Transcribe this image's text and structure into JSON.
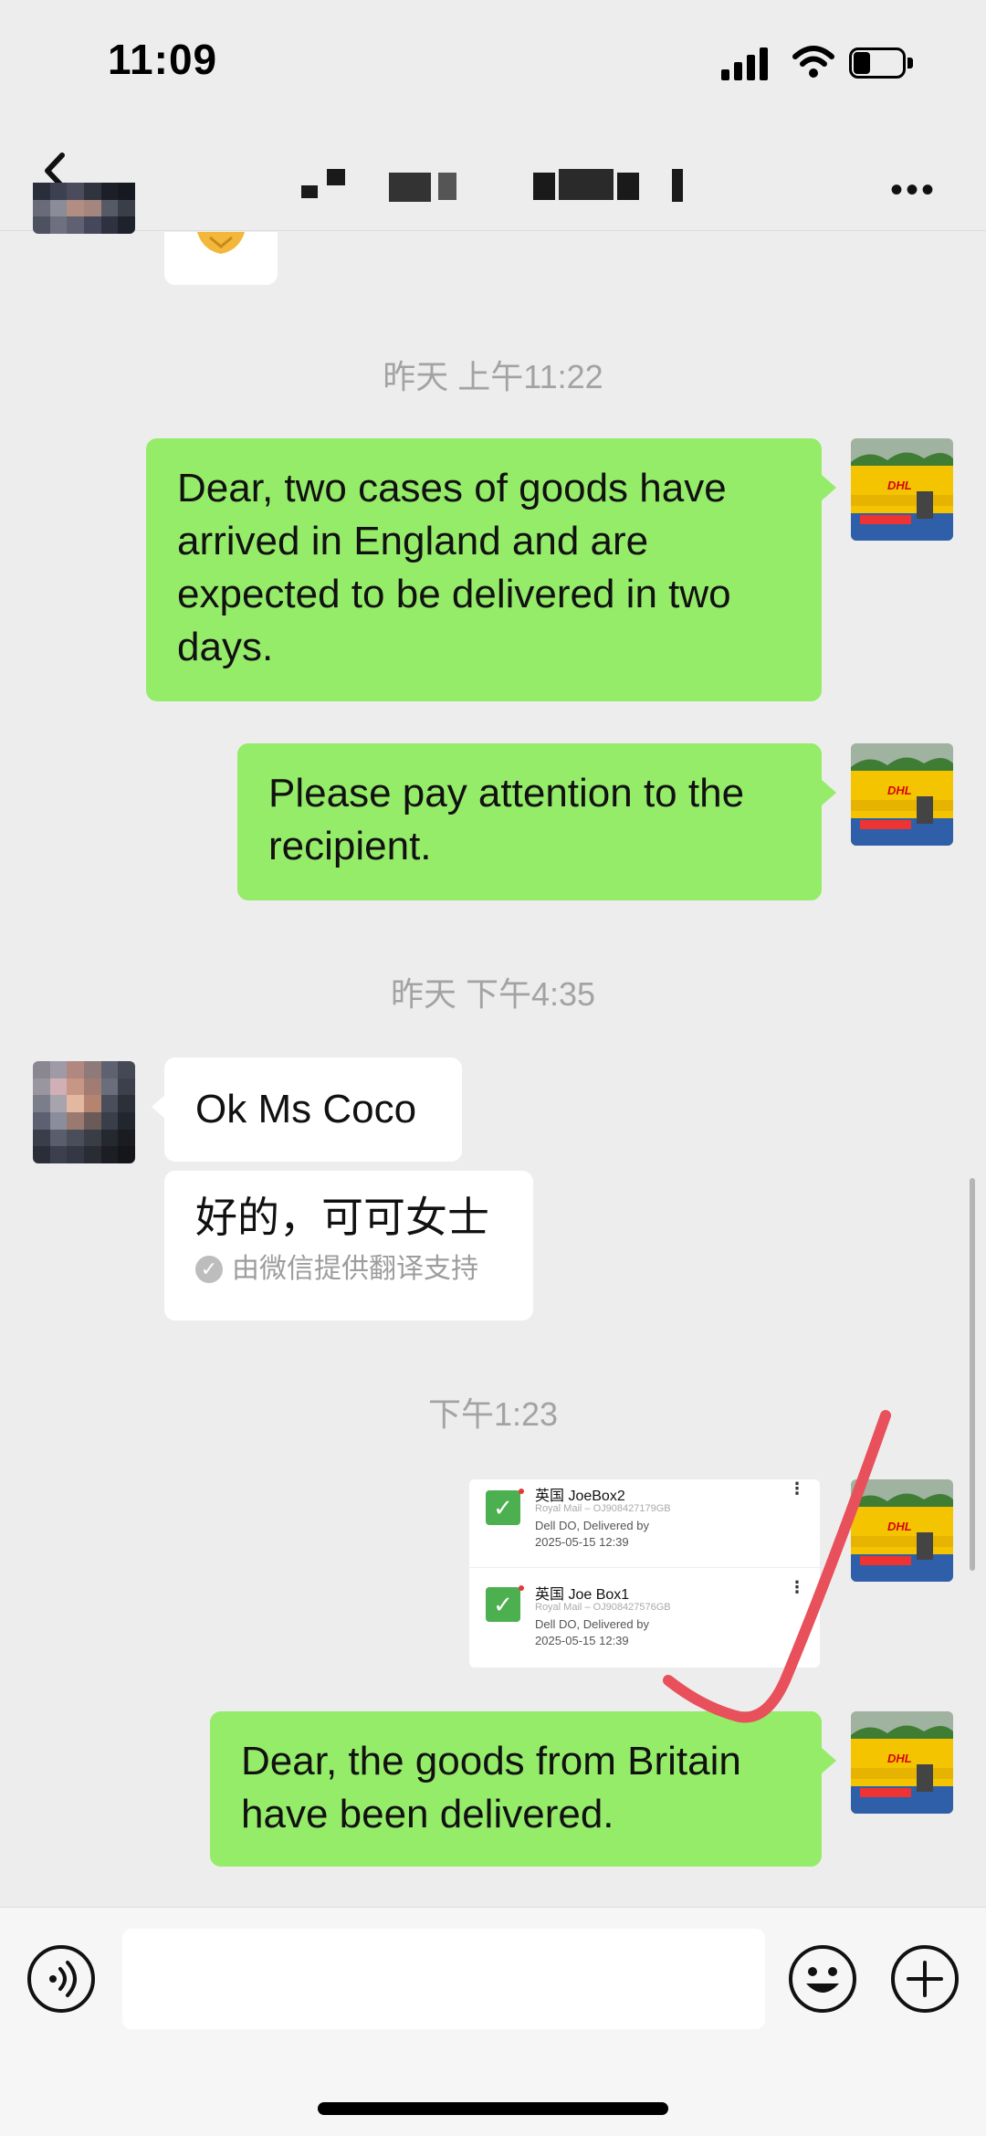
{
  "status_bar": {
    "time": "11:09"
  },
  "header": {
    "title": ""
  },
  "messages": {
    "timestamp_1": "昨天 上午11:22",
    "msg_1": "Dear, two cases of goods have arrived in England and are expected to be delivered in two days.",
    "msg_2": "Please pay attention to the recipient.",
    "timestamp_2": "昨天 下午4:35",
    "msg_3": "Ok Ms Coco",
    "msg_3_translation": "好的，可可女士",
    "translation_note": "由微信提供翻译支持",
    "timestamp_3": "下午1:23",
    "msg_5": "Dear, the goods from Britain have been delivered."
  },
  "packages": [
    {
      "title": "英国 JoeBox2",
      "carrier": "Royal Mail – OJ908427179GB",
      "status": "Dell DO, Delivered by",
      "date": "2025-05-15 12:39"
    },
    {
      "title": "英国 Joe Box1",
      "carrier": "Royal Mail – OJ908427576GB",
      "status": "Dell DO, Delivered by",
      "date": "2025-05-15 12:39"
    }
  ],
  "avatar_text": "DHL",
  "icons": {
    "back": "chevron-left-icon",
    "more": "more-icon",
    "voice": "voice-icon",
    "emoji": "emoji-icon",
    "plus": "plus-icon",
    "check": "check-icon"
  },
  "colors": {
    "bubble_green": "#95ec69",
    "background": "#ededed",
    "dhl_yellow": "#f5c400",
    "dhl_red": "#d40511"
  }
}
